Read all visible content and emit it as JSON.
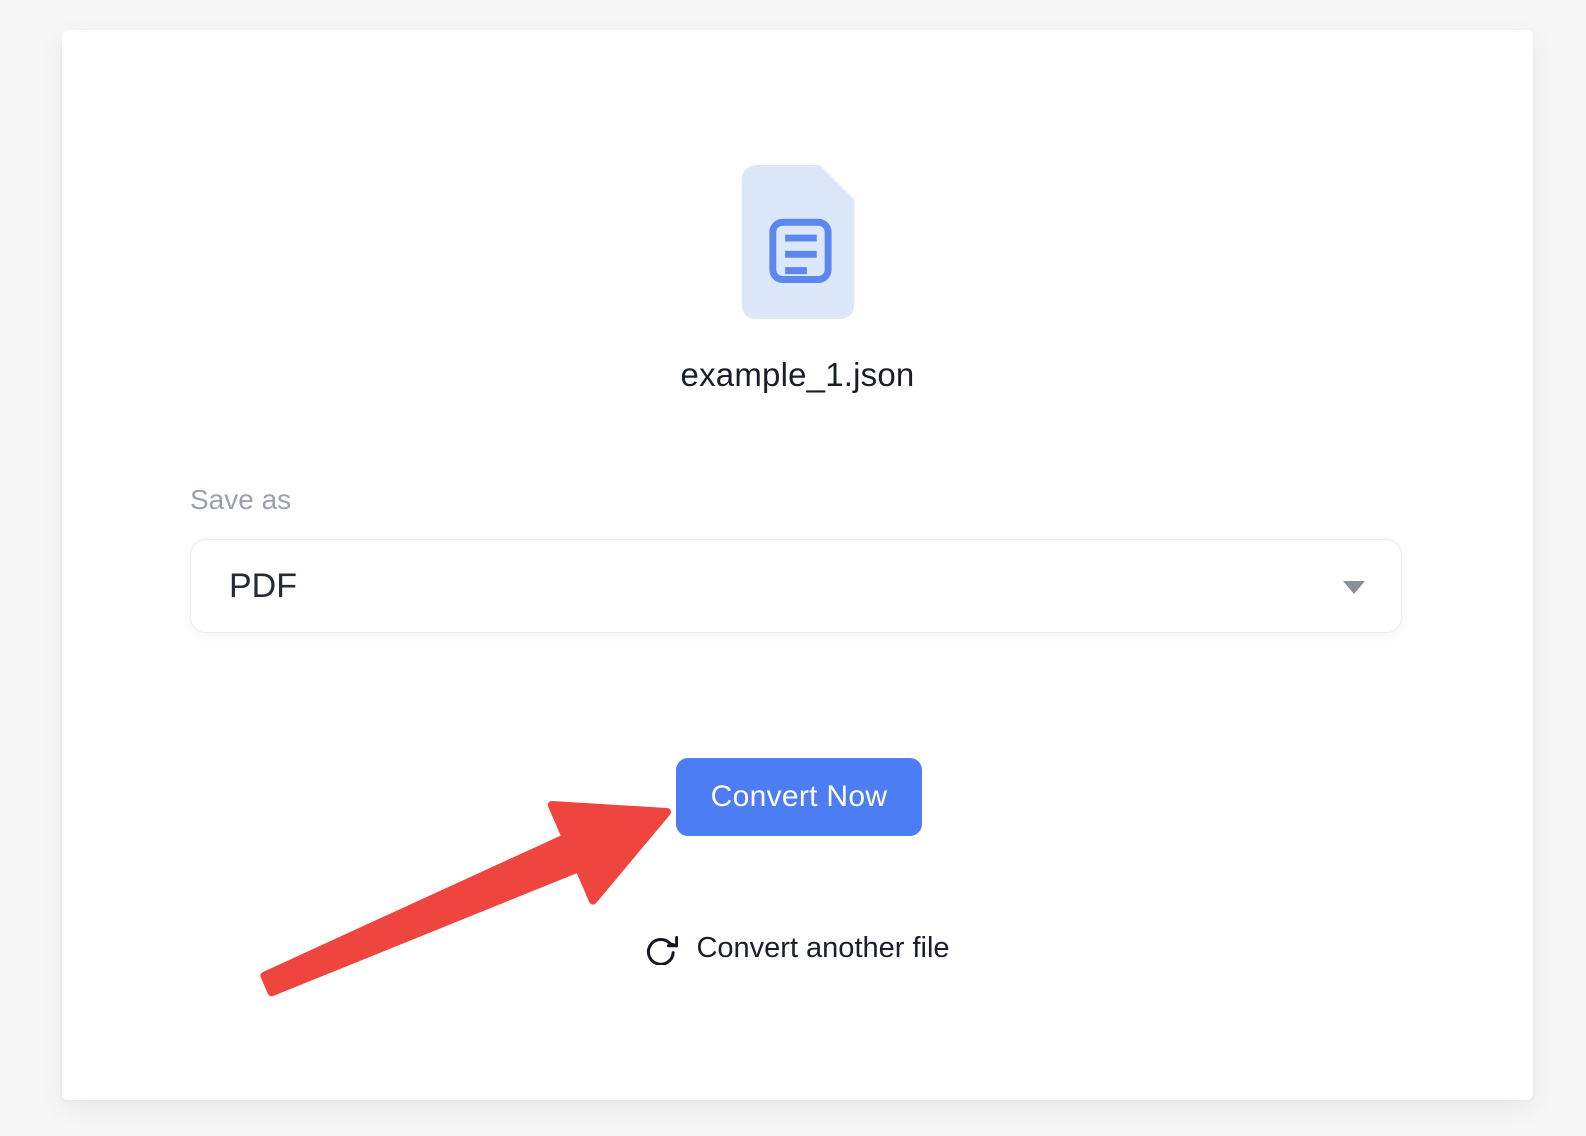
{
  "theme": {
    "page_bg": "#f7f7f8",
    "card_bg": "#ffffff",
    "file_icon_bg": "#dce7fa",
    "file_icon_glyph": "#5b87ef",
    "button_blue": "#4d7df3",
    "button_text": "#ffffff",
    "arrow_red": "#ee453e",
    "text_dark": "#191e28",
    "text_gray": "#9aa1ad",
    "caret_gray": "#8a9099"
  },
  "file_preview": {
    "file_name": "example_1.json",
    "icon_name": "file-document-icon"
  },
  "format_select": {
    "label": "Save as",
    "value": "PDF",
    "caret_icon": "chevron-down-icon"
  },
  "convert": {
    "button_label": "Convert Now"
  },
  "secondary_action": {
    "label": "Convert another file",
    "icon_name": "refresh-icon"
  },
  "annotation": {
    "icon_name": "red-arrow-annotation",
    "color": "#ee453e",
    "points_to": "convert-now-button"
  }
}
